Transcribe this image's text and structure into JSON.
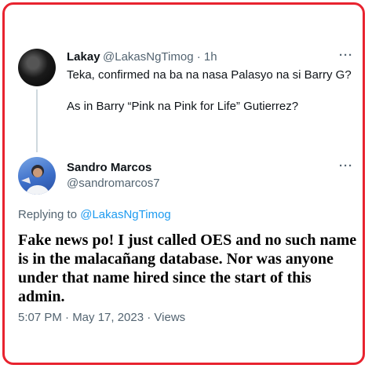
{
  "parent_tweet": {
    "display_name": "Lakay",
    "handle": "@LakasNgTimog",
    "separator": "·",
    "time": "1h",
    "more": "···",
    "line1": "Teka, confirmed na ba na nasa Palasyo na si Barry G?",
    "line2": "As in Barry “Pink na Pink for Life” Gutierrez?"
  },
  "reply_tweet": {
    "display_name": "Sandro Marcos",
    "handle": "@sandromarcos7",
    "more": "···",
    "replying_prefix": "Replying to ",
    "replying_handle": "@LakasNgTimog",
    "text": "Fake news po! I just called OES and no such name is in the malacañang database. Nor was anyone under that name hired since the start of this admin.",
    "timestamp": "5:07 PM · May 17, 2023 ·",
    "views_label": "Views"
  },
  "colors": {
    "frame_border": "#e8232f",
    "link": "#1d9bf0",
    "secondary_text": "#536471"
  }
}
